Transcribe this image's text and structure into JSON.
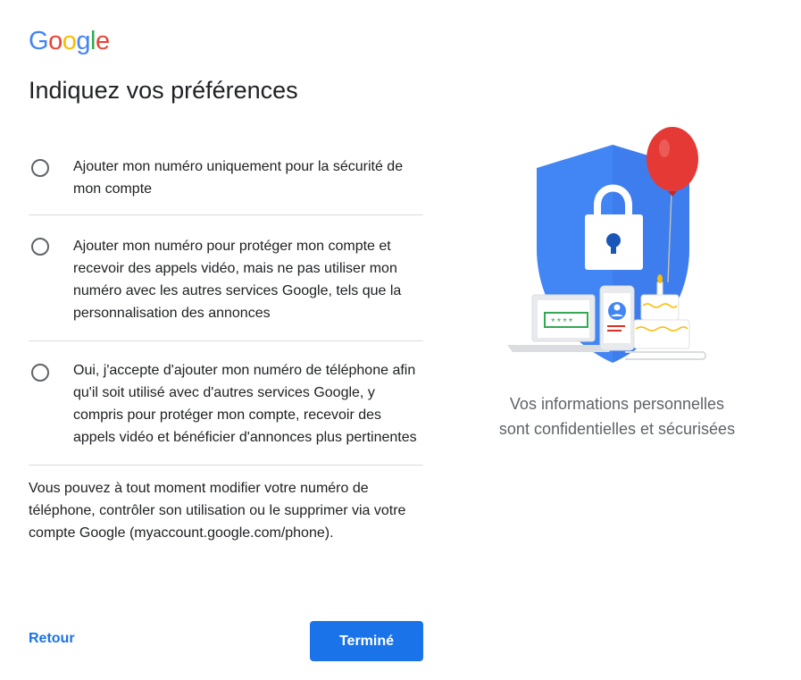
{
  "logo": {
    "letters": [
      "G",
      "o",
      "o",
      "g",
      "l",
      "e"
    ]
  },
  "page_title": "Indiquez vos préférences",
  "options": [
    {
      "label": "Ajouter mon numéro uniquement pour la sécurité de mon compte",
      "selected": false
    },
    {
      "label": "Ajouter mon numéro pour protéger mon compte et recevoir des appels vidéo, mais ne pas utiliser mon numéro avec les autres services Google, tels que la personnalisation des annonces",
      "selected": false
    },
    {
      "label": "Oui, j'accepte d'ajouter mon numéro de téléphone afin qu'il soit utilisé avec d'autres services Google, y compris pour protéger mon compte, recevoir des appels vidéo et bénéficier d'annonces plus pertinentes",
      "selected": false
    }
  ],
  "footnote": "Vous pouvez à tout moment modifier votre numéro de téléphone, contrôler son utilisation ou le supprimer via votre compte Google (myaccount.google.com/phone).",
  "buttons": {
    "back": "Retour",
    "done": "Terminé"
  },
  "illustration": {
    "password_mask": "****"
  },
  "caption": {
    "line1": "Vos informations personnelles",
    "line2": "sont confidentielles et sécurisées"
  },
  "colors": {
    "accent": "#1a73e8",
    "shield": "#4285F4",
    "balloon": "#EA4335"
  }
}
